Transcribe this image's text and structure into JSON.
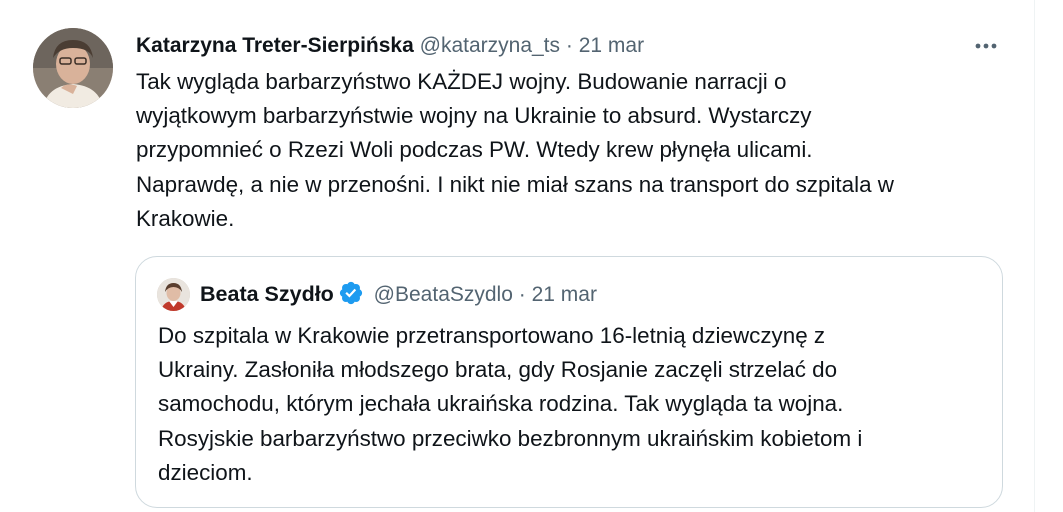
{
  "tweet": {
    "author_name": "Katarzyna Treter-Sierpińska",
    "author_handle": "@katarzyna_ts",
    "separator": " · ",
    "date": "21 mar",
    "more_icon": "more-horizontal-icon",
    "lines": [
      "Tak wygląda barbarzyństwo KAŻDEJ wojny. Budowanie narracji o",
      "wyjątkowym barbarzyństwie wojny na Ukrainie to absurd. Wystarczy",
      "przypomnieć o Rzezi Woli podczas PW. Wtedy krew płynęła ulicami.",
      "Naprawdę, a nie w przenośni. I nikt nie miał szans na transport do szpitala w",
      "Krakowie."
    ]
  },
  "quoted": {
    "author_name": "Beata Szydło",
    "author_handle": "@BeataSzydlo",
    "separator": " · ",
    "date": "21 mar",
    "verified_icon": "verified-badge-icon",
    "lines": [
      "Do szpitala w Krakowie przetransportowano 16-letnią dziewczynę z",
      "Ukrainy. Zasłoniła młodszego brata, gdy Rosjanie zaczęli strzelać do",
      "samochodu, którym jechała ukraińska rodzina. Tak wygląda ta wojna.",
      "Rosyjskie barbarzyństwo przeciwko bezbronnym ukraińskim kobietom i",
      "dzieciom."
    ]
  },
  "colors": {
    "text": "#0f1419",
    "secondary": "#536471",
    "border": "#cfd9de",
    "verified": "#1d9bf0"
  }
}
